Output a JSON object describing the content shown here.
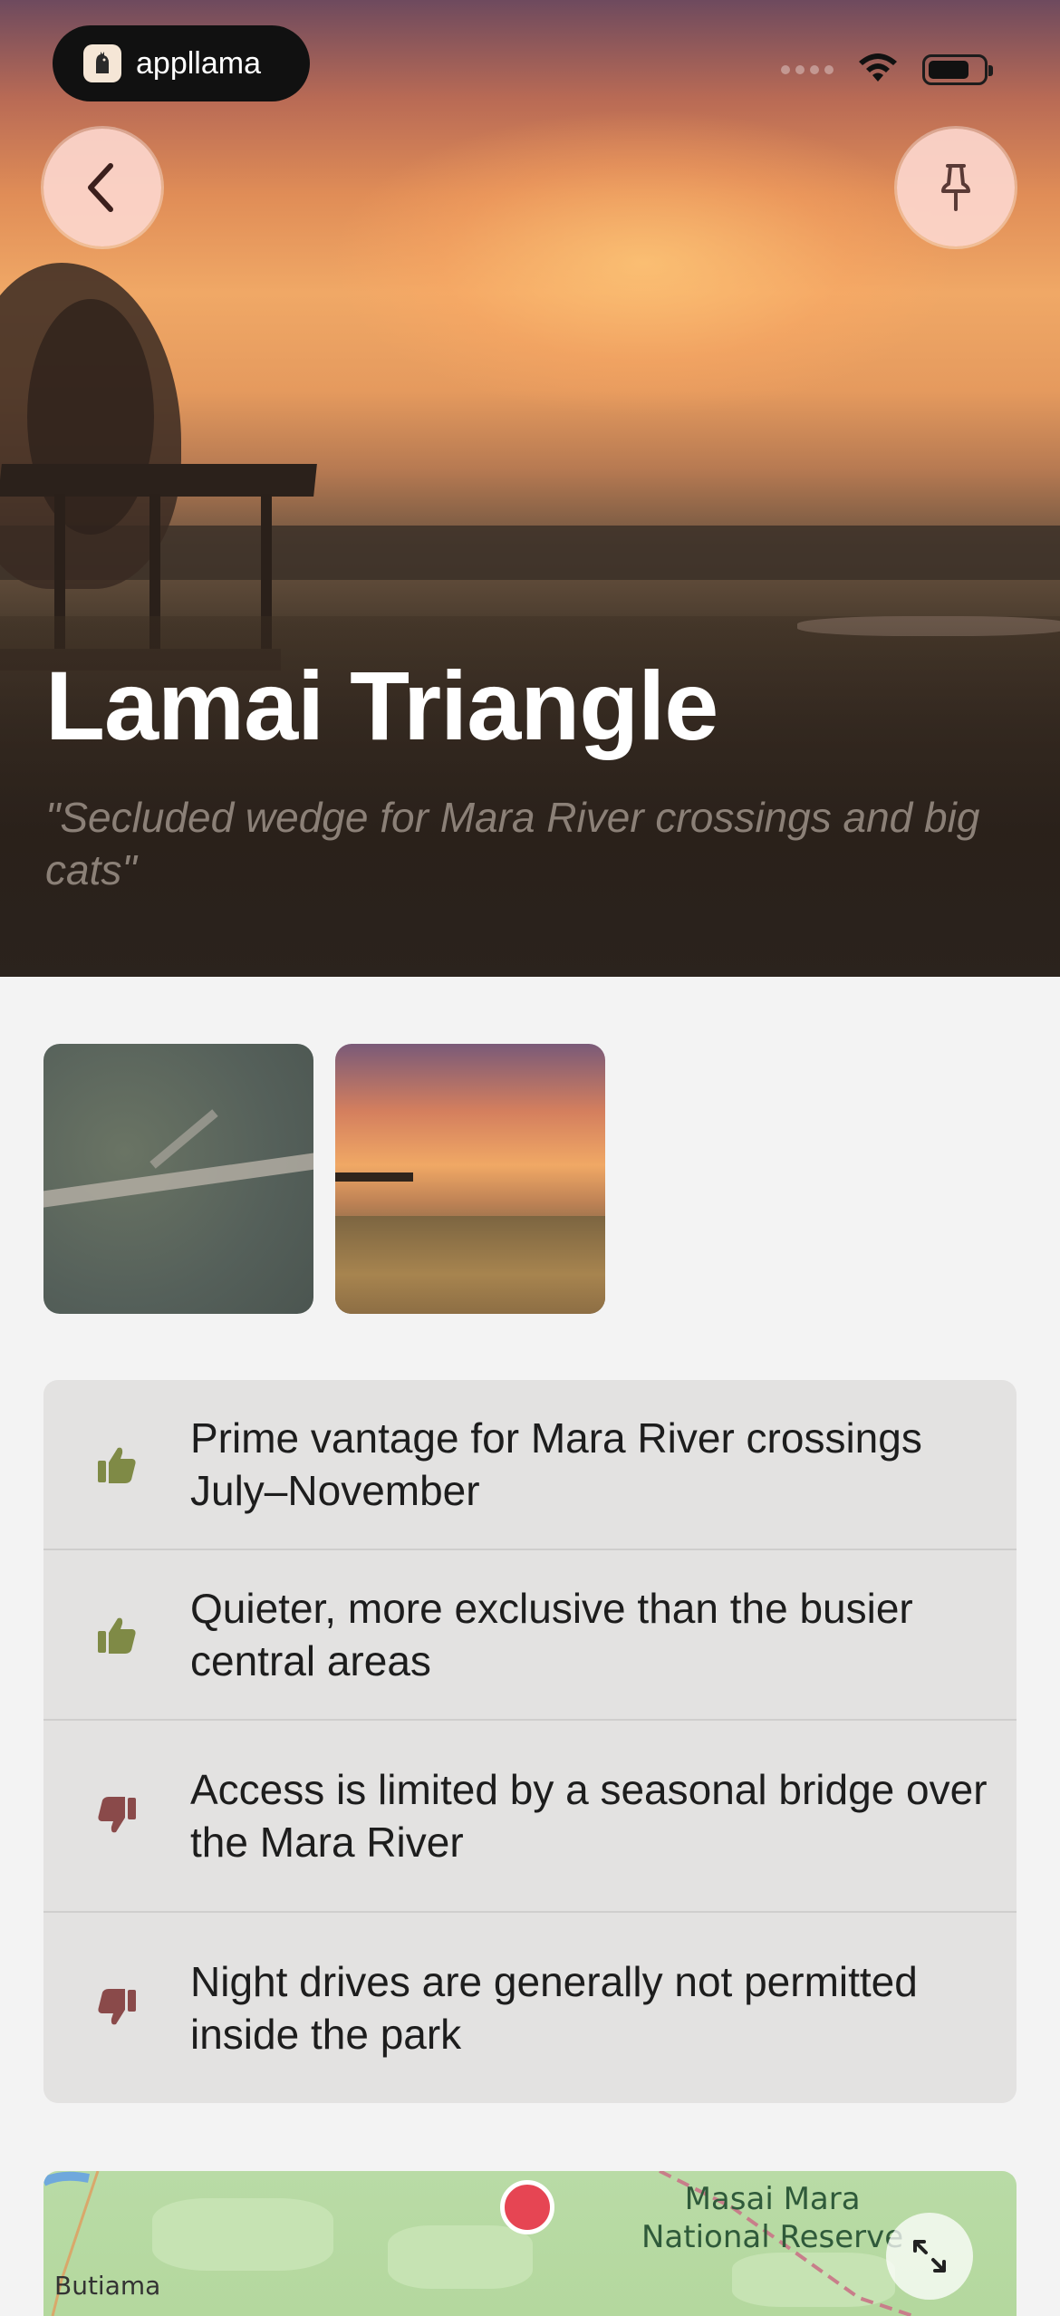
{
  "status_bar": {
    "app_badge": "appllama",
    "icons": [
      "signal-dots-icon",
      "wifi-icon",
      "battery-icon"
    ]
  },
  "hero": {
    "title": "Lamai Triangle",
    "subtitle": "\"Secluded wedge for Mara River crossings and big cats\""
  },
  "buttons": {
    "back_icon": "chevron-left-icon",
    "pin_icon": "pin-icon"
  },
  "gallery": {
    "images": [
      "satellite-image",
      "sunset-image"
    ]
  },
  "pros_cons": [
    {
      "type": "pro",
      "icon": "thumbs-up-icon",
      "color": "#7f8a46",
      "text": "Prime vantage for Mara River crossings July–November"
    },
    {
      "type": "pro",
      "icon": "thumbs-up-icon",
      "color": "#7f8a46",
      "text": "Quieter, more exclusive than the busier central areas"
    },
    {
      "type": "con",
      "icon": "thumbs-down-icon",
      "color": "#8a4a4a",
      "text": "Access is limited by a seasonal bridge over the Mara River"
    },
    {
      "type": "con",
      "icon": "thumbs-down-icon",
      "color": "#8a4a4a",
      "text": "Night drives are generally not permitted inside the park"
    }
  ],
  "map": {
    "reserve_label_line1": "Masai Mara",
    "reserve_label_line2": "National Reserve",
    "town_label": "Butiama",
    "pin_color": "#e64553"
  }
}
